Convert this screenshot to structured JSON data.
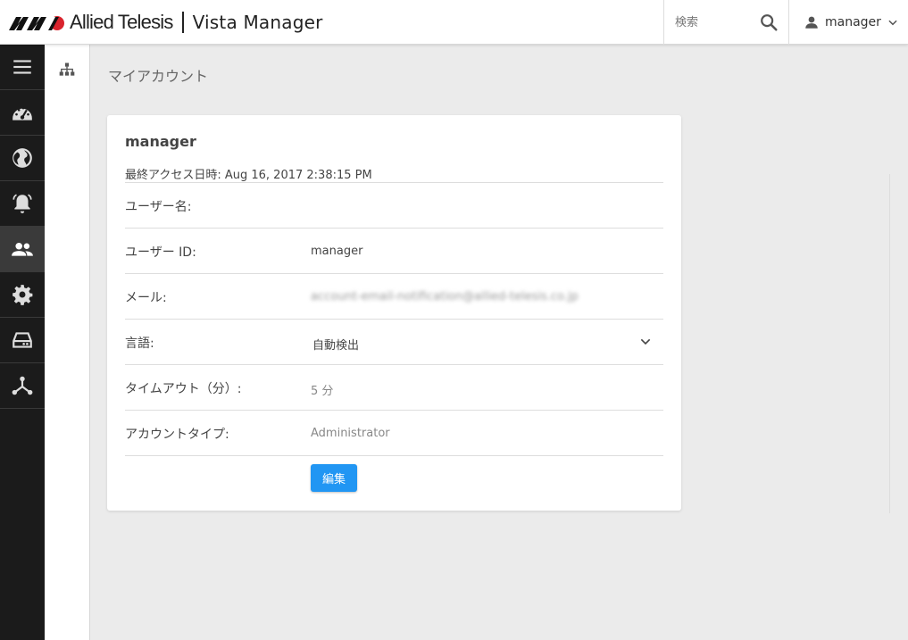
{
  "header": {
    "company": "Allied Telesis",
    "product": "Vista Manager",
    "search_placeholder": "検索",
    "user_name": "manager"
  },
  "sidebar": {
    "items": [
      {
        "icon": "menu-icon",
        "active": false
      },
      {
        "icon": "dashboard-icon",
        "active": false
      },
      {
        "icon": "globe-icon",
        "active": false
      },
      {
        "icon": "alarm-bell-icon",
        "active": false
      },
      {
        "icon": "users-icon",
        "active": true
      },
      {
        "icon": "gear-icon",
        "active": false
      },
      {
        "icon": "storage-icon",
        "active": false
      },
      {
        "icon": "network-icon",
        "active": false
      }
    ]
  },
  "main": {
    "page_title": "マイアカウント",
    "card": {
      "title": "manager",
      "last_access": "最終アクセス日時: Aug 16, 2017 2:38:15 PM",
      "rows": [
        {
          "label": "ユーザー名:",
          "value": ""
        },
        {
          "label": "ユーザー ID:",
          "value": "manager"
        },
        {
          "label": "メール:",
          "value": "account-email-notification@allied-telesis.co.jp"
        },
        {
          "label": "言語:",
          "value": "自動検出"
        },
        {
          "label": "タイムアウト（分）:",
          "value": "5 分"
        },
        {
          "label": "アカウントタイプ:",
          "value": "Administrator"
        }
      ],
      "edit_label": "編集"
    }
  }
}
